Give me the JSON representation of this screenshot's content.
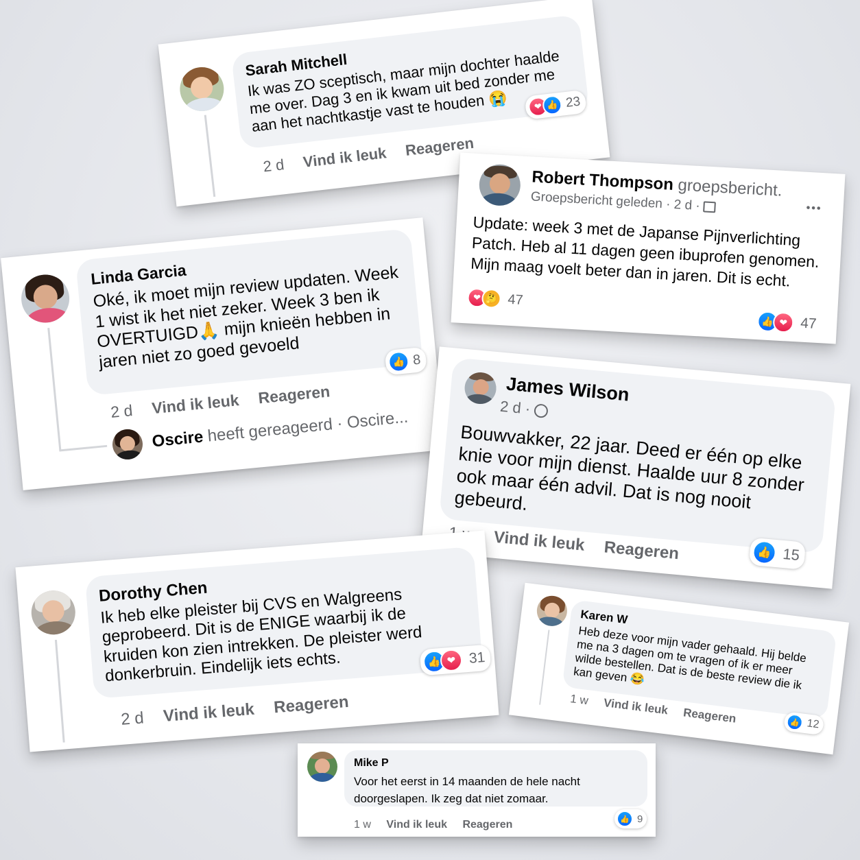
{
  "comments": [
    {
      "name": "Sarah Mitchell",
      "text": "Ik was ZO sceptisch, maar mijn dochter haalde me over. Dag 3 en ik kwam uit bed zonder me aan het nachtkastje vast te houden 😭",
      "time": "2 d",
      "like": "Vind ik leuk",
      "reply": "Reageren",
      "count": "23",
      "reactions": [
        "heart-icon",
        "like-icon"
      ]
    },
    {
      "name": "Robert Thompson",
      "suffix": "groepsbericht.",
      "sub": "Groepsbericht geleden · 2 d ·",
      "text": "Update: week 3 met de Japanse Pijnverlichting Patch. Heb al 11 dagen geen ibuprofen genomen. Mijn maag voelt beter dan in jaren. Dit is echt.",
      "count_top": "47",
      "count_bottom": "47",
      "more": "•••"
    },
    {
      "name": "Linda Garcia",
      "text": "Oké, ik moet mijn review updaten. Week 1 wist ik het niet zeker. Week 3 ben ik OVERTUIGD🙏 mijn knieën hebben in jaren niet zo goed gevoeld",
      "time": "2 d",
      "like": "Vind ik leuk",
      "reply": "Reageren",
      "count": "8",
      "reply_name": "Oscire",
      "reply_text": "heeft gereageerd · Oscire..."
    },
    {
      "name": "James Wilson",
      "sub": "2 d ·",
      "text": "Bouwvakker, 22 jaar. Deed er één op elke knie voor mijn dienst. Haalde uur 8 zonder ook maar één advil. Dat is nog nooit gebeurd.",
      "time": "1 w",
      "like": "Vind ik leuk",
      "reply": "Reageren",
      "count": "15"
    },
    {
      "name": "Dorothy Chen",
      "text": "Ik heb elke pleister bij CVS en Walgreens geprobeerd. Dit is de ENIGE waarbij ik de kruiden kon zien intrekken. De pleister werd donkerbruin. Eindelijk iets echts.",
      "time": "2 d",
      "like": "Vind ik leuk",
      "reply": "Reageren",
      "count": "31"
    },
    {
      "name": "Karen W",
      "text": "Heb deze voor mijn vader gehaald. Hij belde me na 3 dagen om te vragen of ik er meer wilde bestellen. Dat is de beste review die ik kan geven 😂",
      "time": "1 w",
      "like": "Vind ik leuk",
      "reply": "Reageren",
      "count": "12"
    },
    {
      "name": "Mike P",
      "text": "Voor het eerst in 14 maanden de hele nacht doorgeslapen. Ik zeg dat niet zomaar.",
      "time": "1 w",
      "like": "Vind ik leuk",
      "reply": "Reageren",
      "count": "9"
    }
  ],
  "colors": {
    "like": "#0866ff",
    "love": "#e61e4d",
    "bubble": "#f0f2f5",
    "meta": "#65676b"
  }
}
